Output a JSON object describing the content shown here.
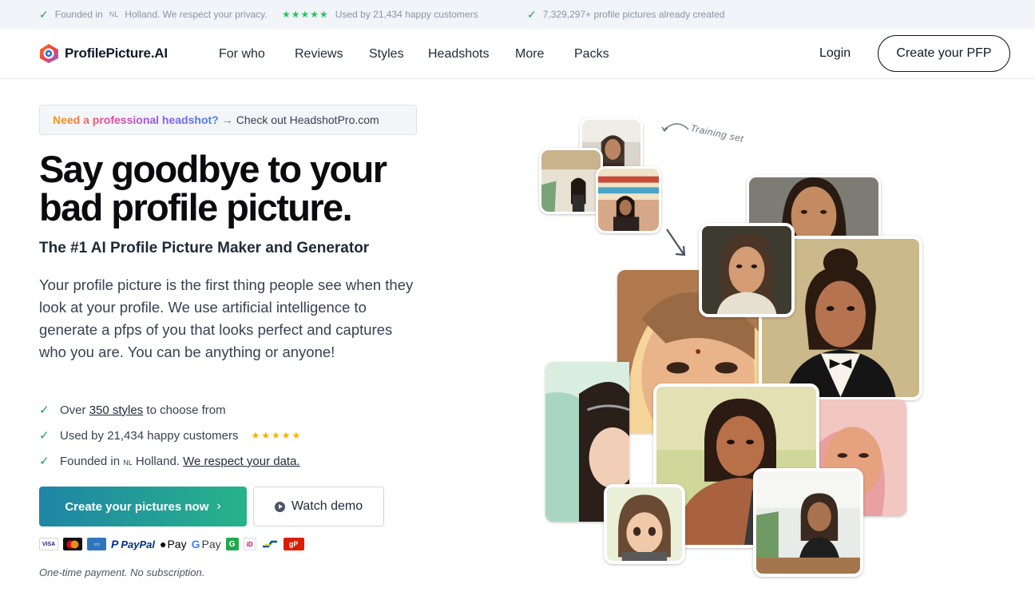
{
  "topbar": {
    "founded_prefix": "Founded in",
    "founded_flag": "NL",
    "founded_suffix": "Holland. We respect your privacy.",
    "stars": "★★★★★",
    "used_by": "Used by 21,434 happy customers",
    "created": "7,329,297+ profile pictures already created"
  },
  "header": {
    "logo_text": "ProfilePicture.AI",
    "nav": [
      "For who",
      "Reviews",
      "Styles",
      "Headshots",
      "More",
      "Packs"
    ],
    "login": "Login",
    "cta": "Create your PFP"
  },
  "banner": {
    "grad_text": "Need a professional headshot?",
    "arrow": "→",
    "link_text": "Check out HeadshotPro.com"
  },
  "hero": {
    "headline_line1": "Say goodbye to your",
    "headline_line2": "bad profile picture.",
    "subhead": "The #1 AI Profile Picture Maker and Generator",
    "paragraph": "Your profile picture is the first thing people see when they look at your profile. We use artificial intelligence to generate a pfps of you that looks perfect and captures who you are. You can be anything or anyone!",
    "features": {
      "f1_prefix": "Over",
      "f1_link": "350 styles",
      "f1_suffix": "to choose from",
      "f2": "Used by 21,434 happy customers",
      "f2_stars": "★★★★★",
      "f3_prefix": "Founded in",
      "f3_flag": "NL",
      "f3_mid": "Holland.",
      "f3_link": "We respect your data."
    },
    "primary_button": "Create your pictures now",
    "primary_chevron": "›",
    "secondary_button": "Watch demo",
    "payments": {
      "visa": "VISA",
      "paypal": "PayPal",
      "apple_pay": "Pay",
      "google_pay": "Pay"
    },
    "note": "One-time payment. No subscription."
  },
  "collage": {
    "training_label": "Training set"
  },
  "colors": {
    "check_green": "#16a34a",
    "star_gold": "#f5b301",
    "primary_start": "#1f85a6",
    "primary_end": "#27b38a"
  }
}
